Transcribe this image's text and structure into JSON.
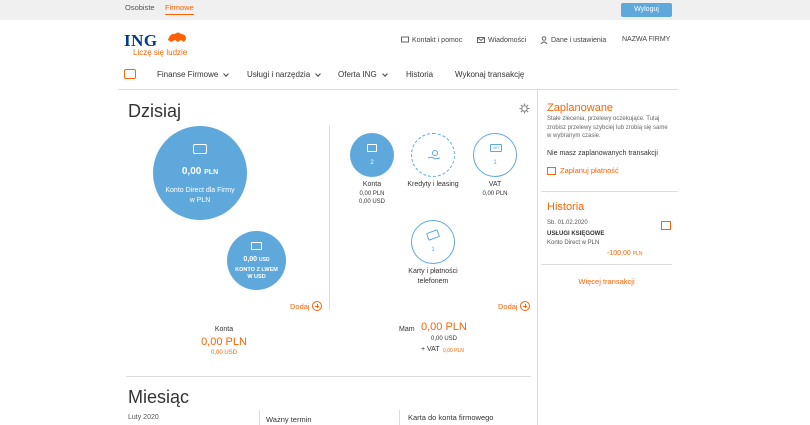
{
  "topbar": {
    "tab_personal": "Osobiste",
    "tab_business": "Firmowe",
    "logout": "Wyloguj"
  },
  "brand": {
    "name": "ING",
    "tagline": "Liczę się ludzie"
  },
  "util": {
    "contact": "Kontakt i pomoc",
    "messages": "Wiadomości",
    "settings": "Dane i ustawienia",
    "company": "NAZWA FIRMY"
  },
  "nav": {
    "items": [
      "Finanse Firmowe",
      "Usługi i narzędzia",
      "Oferta ING",
      "Historia",
      "Wykonaj transakcję"
    ]
  },
  "today": {
    "title": "Dzisiaj",
    "main_account": {
      "amount": "0,00",
      "currency": "PLN",
      "name": "Konto Direct dla Firmy w PLN"
    },
    "second_account": {
      "amount": "0,00",
      "currency": "USD",
      "name": "KONTO Z LWEM W USD"
    },
    "add_label": "Dodaj",
    "accounts_summary": {
      "label": "Konta",
      "pln": "0,00 PLN",
      "usd": "0,00 USD"
    },
    "products": {
      "konta": {
        "count": "2",
        "label": "Konta",
        "pln": "0,00 PLN",
        "usd": "0,00 USD"
      },
      "kredyty": {
        "label": "Kredyty i leasing"
      },
      "vat": {
        "badge": "VAT",
        "count": "1",
        "label": "VAT",
        "pln": "0,00 PLN"
      },
      "karty": {
        "count": "1",
        "label": "Karty i płatności telefonem"
      }
    },
    "mam": {
      "label": "Mam",
      "pln": "0,00 PLN",
      "usd": "0,00 USD",
      "vat_prefix": "+ VAT",
      "vat_pln": "0,00 PLN"
    }
  },
  "month": {
    "title": "Miesiąc",
    "date": "Luty 2020",
    "col2": "Ważny termin",
    "col3": "Karta do konta firmowego"
  },
  "planned": {
    "title": "Zaplanowane",
    "desc": "Stałe zlecenia, przelewy oczekujące. Tutaj zrobisz przelewy szybciej lub zrobią się same w wybranym czasie.",
    "empty": "Nie masz zaplanowanych transakcji",
    "action": "Zaplanuj płatność"
  },
  "history": {
    "title": "Historia",
    "date": "Sb. 01.02.2020",
    "name": "USŁUGI KSIĘGOWE",
    "account": "Konto Direct w PLN",
    "amount": "-100,00",
    "currency": "PLN",
    "more": "Więcej transakcji"
  },
  "colors": {
    "accent": "#ff6200",
    "blue": "#5fa8dc",
    "brand": "#003b8e"
  }
}
